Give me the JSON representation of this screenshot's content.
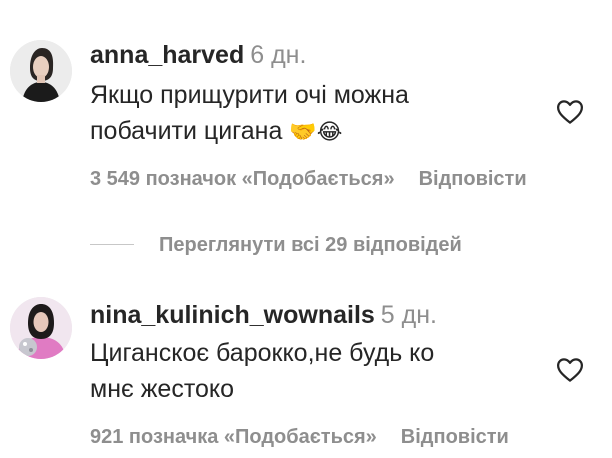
{
  "comments": [
    {
      "username": "anna_harved",
      "time": "6 дн.",
      "text_line1": "Якщо прищурити очі можна",
      "text_line2": "побачити цигана",
      "emojis": "🤝😂",
      "likes": "3 549 позначок «Подобається»",
      "reply_label": "Відповісти"
    },
    {
      "username": "nina_kulinich_wownails",
      "time": "5 дн.",
      "text_line1": "Циганскоє барокко,не будь ко",
      "text_line2": "мнє жестоко",
      "likes": "921 позначка «Подобається»",
      "reply_label": "Відповісти"
    }
  ],
  "view_replies": "Переглянути всі 29 відповідей",
  "icons": [
    "avatar",
    "heart-icon"
  ],
  "colors": {
    "text": "#262626",
    "muted": "#8e8e8e",
    "line": "#c7c7c7"
  }
}
